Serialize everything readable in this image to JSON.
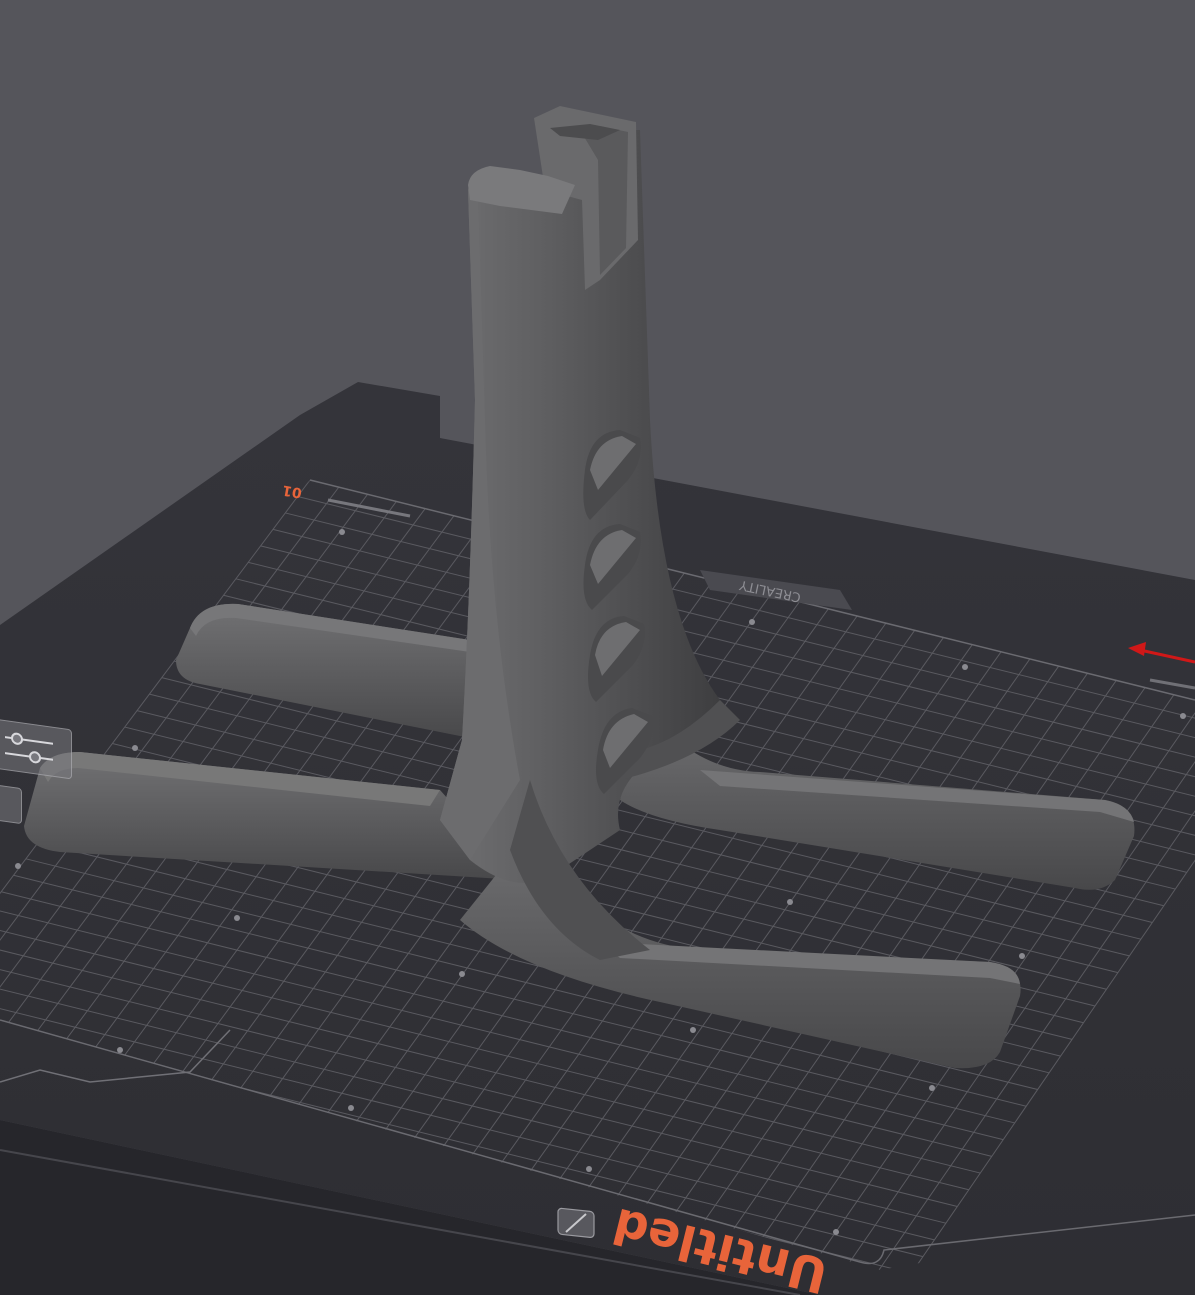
{
  "plate": {
    "plate_number": "01",
    "brand_mark": "CREALITY",
    "plate_name": "Untitled",
    "accent_color": "#e8643a"
  },
  "toolbar": {
    "arrange_icon": "sliders-icon",
    "secondary_icon": "square-icon",
    "edit_name_icon": "pencil-icon"
  },
  "axis": {
    "x_axis_color": "#d01818"
  },
  "model": {
    "color": "#5f5f61"
  }
}
